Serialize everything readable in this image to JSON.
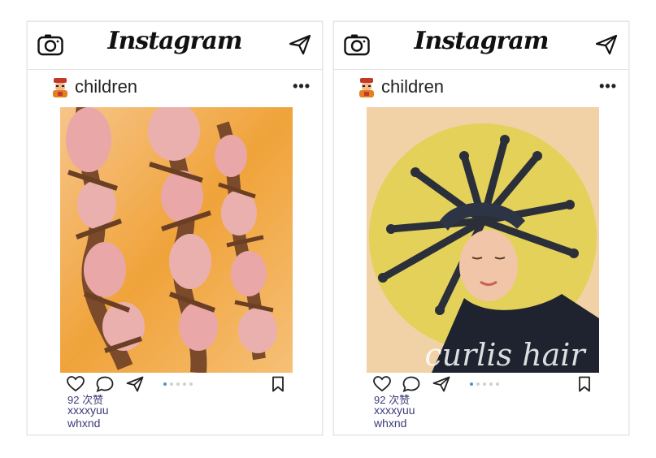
{
  "posts": [
    {
      "app_logo": "Instagram",
      "username": "children",
      "more_label": "•••",
      "likes_text": "92 次赞",
      "caption_line1": "xxxxyuu",
      "caption_line2": "whxnd",
      "carousel": {
        "count": 5,
        "active_index": 0
      },
      "icons": [
        "camera-icon",
        "send-icon",
        "avatar-icon",
        "heart-icon",
        "comment-icon",
        "share-icon",
        "bookmark-icon"
      ]
    },
    {
      "app_logo": "Instagram",
      "username": "children",
      "more_label": "•••",
      "likes_text": "92 次赞",
      "caption_line1": "xxxxyuu",
      "caption_line2": "whxnd",
      "photo_overlay_text": "curlis hair",
      "carousel": {
        "count": 5,
        "active_index": 0
      },
      "icons": [
        "camera-icon",
        "send-icon",
        "avatar-icon",
        "heart-icon",
        "comment-icon",
        "share-icon",
        "bookmark-icon"
      ]
    }
  ],
  "colors": {
    "photo1_bg": "#f0a33a",
    "photo2_bg": "#f0d2a6",
    "circle_bg": "#e3d15a",
    "accent_dot": "#4a90d9"
  }
}
